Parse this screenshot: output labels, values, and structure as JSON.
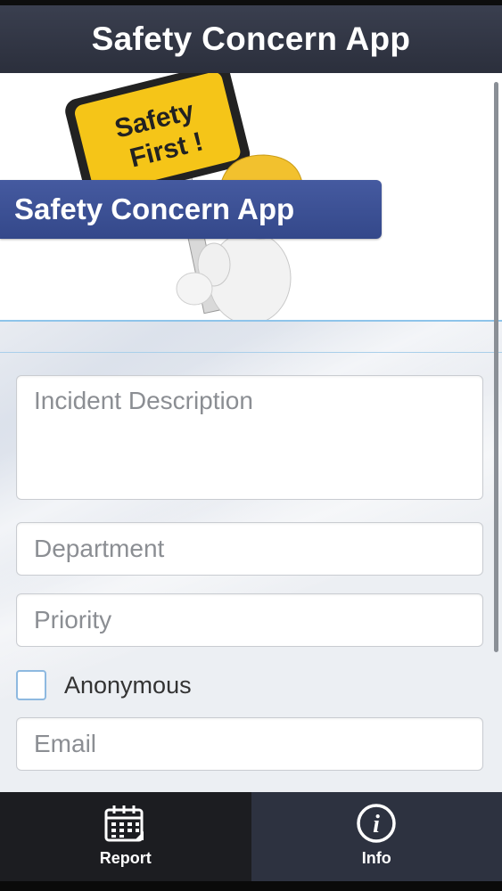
{
  "header": {
    "title": "Safety Concern App"
  },
  "banner": {
    "label": "Safety Concern App",
    "sign_line1": "Safety",
    "sign_line2": "First !"
  },
  "form": {
    "incident_description_placeholder": "Incident Description",
    "department_placeholder": "Department",
    "priority_placeholder": "Priority",
    "anonymous_label": "Anonymous",
    "anonymous_checked": false,
    "email_placeholder": "Email"
  },
  "tabbar": {
    "report_label": "Report",
    "report_icon": "calendar-icon",
    "info_label": "Info",
    "info_icon": "info-icon",
    "active_tab": "Info"
  },
  "colors": {
    "titlebar": "#2f3341",
    "banner_label_bg": "#3d5196",
    "sign_yellow": "#f5c518",
    "tab_report_bg": "#1c1d21",
    "tab_info_bg": "#2d3240"
  }
}
